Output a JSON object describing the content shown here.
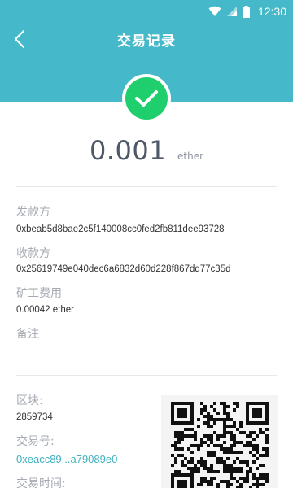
{
  "status_bar": {
    "time": "12:30"
  },
  "header": {
    "title": "交易记录",
    "back_icon": "chevron-left-icon"
  },
  "status": {
    "icon": "checkmark-icon",
    "color": "#1fce6d"
  },
  "amount": {
    "value": "0.001",
    "unit": "ether"
  },
  "details": {
    "from_label": "发款方",
    "from_value": "0xbeab5d8bae2c5f140008cc0fed2fb811dee93728",
    "to_label": "收款方",
    "to_value": "0x25619749e040dec6a6832d60d228f867dd77c35d",
    "fee_label": "矿工费用",
    "fee_value": "0.00042 ether",
    "note_label": "备注",
    "note_value": ""
  },
  "block": {
    "block_label": "区块:",
    "block_value": "2859734",
    "tx_label": "交易号:",
    "tx_value": "0xeacc89...a79089e0",
    "time_label": "交易时间:"
  },
  "colors": {
    "accent": "#45b9c9",
    "link": "#3fb1c0",
    "label": "#a6abb2"
  }
}
